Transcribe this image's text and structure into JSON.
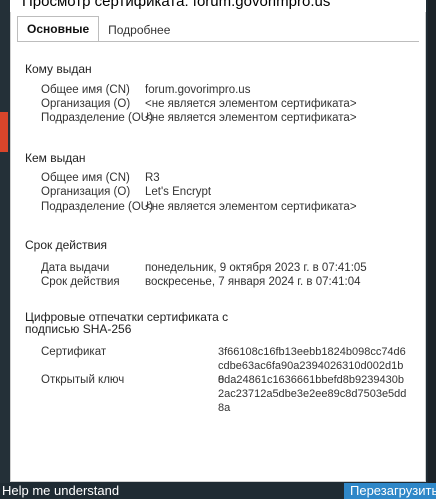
{
  "window": {
    "title": "Просмотр сертификата: forum.govorimpro.us"
  },
  "tabs": [
    {
      "label": "Основные",
      "active": true
    },
    {
      "label": "Подробнее",
      "active": false
    }
  ],
  "issued_to": {
    "heading": "Кому выдан",
    "rows": [
      {
        "label": "Общее имя (CN)",
        "value": "forum.govorimpro.us"
      },
      {
        "label": "Организация (O)",
        "value": "<не является элементом сертификата>"
      },
      {
        "label": "Подразделение (OU)",
        "value": "<не является элементом сертификата>"
      }
    ]
  },
  "issued_by": {
    "heading": "Кем выдан",
    "rows": [
      {
        "label": "Общее имя (CN)",
        "value": "R3"
      },
      {
        "label": "Организация (O)",
        "value": "Let's Encrypt"
      },
      {
        "label": "Подразделение (OU)",
        "value": "<не является элементом сертификата>"
      }
    ]
  },
  "validity": {
    "heading": "Срок действия",
    "rows": [
      {
        "label": "Дата выдачи",
        "value": "понедельник, 9 октября 2023 г. в 07:41:05"
      },
      {
        "label": "Срок действия",
        "value": "воскресенье, 7 января 2024 г. в 07:41:04"
      }
    ]
  },
  "fingerprints": {
    "heading_line1": "Цифровые отпечатки сертификата с",
    "heading_line2": "подписью SHA-256",
    "rows": [
      {
        "label": "Сертификат",
        "value": "3f66108c16fb13eebb1824b098cc74d6cdbe63ac6fa90a2394026310d002d1b8"
      },
      {
        "label": "Открытый ключ",
        "value": "0da24861c1636661bbefd8b9239430b2ac23712a5dbe3e2ee89c8d7503e5dd8a"
      }
    ]
  },
  "background": {
    "bottom_left_text": "Help me understand",
    "bottom_right_text": "Перезагрузить"
  },
  "colors": {
    "accent_button": "#2e87c8",
    "dialog_bg": "#ffffff",
    "backdrop": "#1f2b33"
  }
}
